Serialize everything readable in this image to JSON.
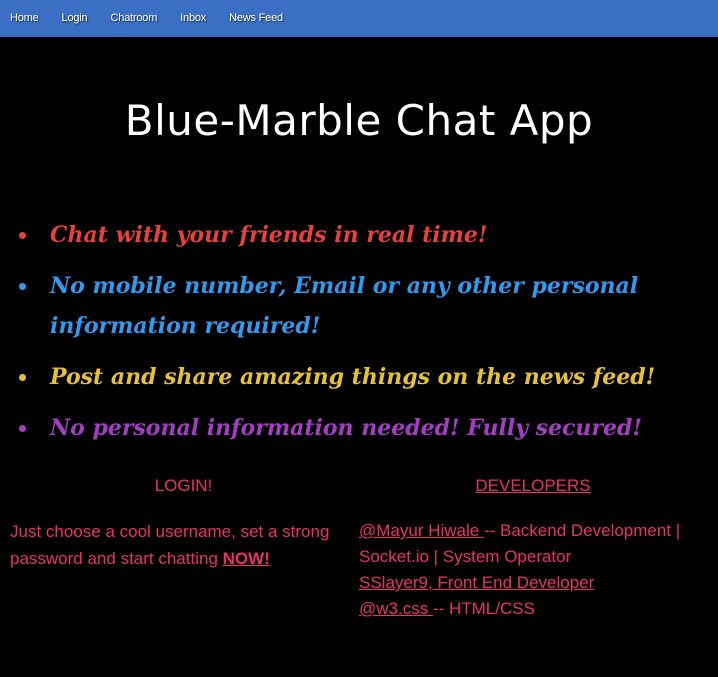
{
  "nav": {
    "items": [
      {
        "label": "Home"
      },
      {
        "label": "Login"
      },
      {
        "label": "Chatroom"
      },
      {
        "label": "Inbox"
      },
      {
        "label": "News Feed"
      }
    ]
  },
  "title": "Blue-Marble Chat App",
  "features": [
    {
      "text": "Chat with your friends in real time!",
      "color": "#e8413a"
    },
    {
      "text": "No mobile number, Email or any other personal information required!",
      "color": "#2f9bf0"
    },
    {
      "text": "Post and share amazing things on the news feed!",
      "color": "#e6c131"
    },
    {
      "text": "No personal information needed! Fully secured!",
      "color": "#a43dc4"
    }
  ],
  "login": {
    "heading": "LOGIN!",
    "text": "Just choose a cool username, set a strong password and start chatting ",
    "now_label": "NOW!"
  },
  "developers": {
    "heading": "DEVELOPERS",
    "line1_link": "@Mayur Hiwale ",
    "line1_text": "-- Backend Development | Socket.io | System Operator",
    "line2_link": "SSlayer9, Front End Developer",
    "line3_link": "@w3.css ",
    "line3_text": "-- HTML/CSS"
  },
  "colors": {
    "navbar": "#3a6fc4",
    "accent": "#e8316b"
  }
}
